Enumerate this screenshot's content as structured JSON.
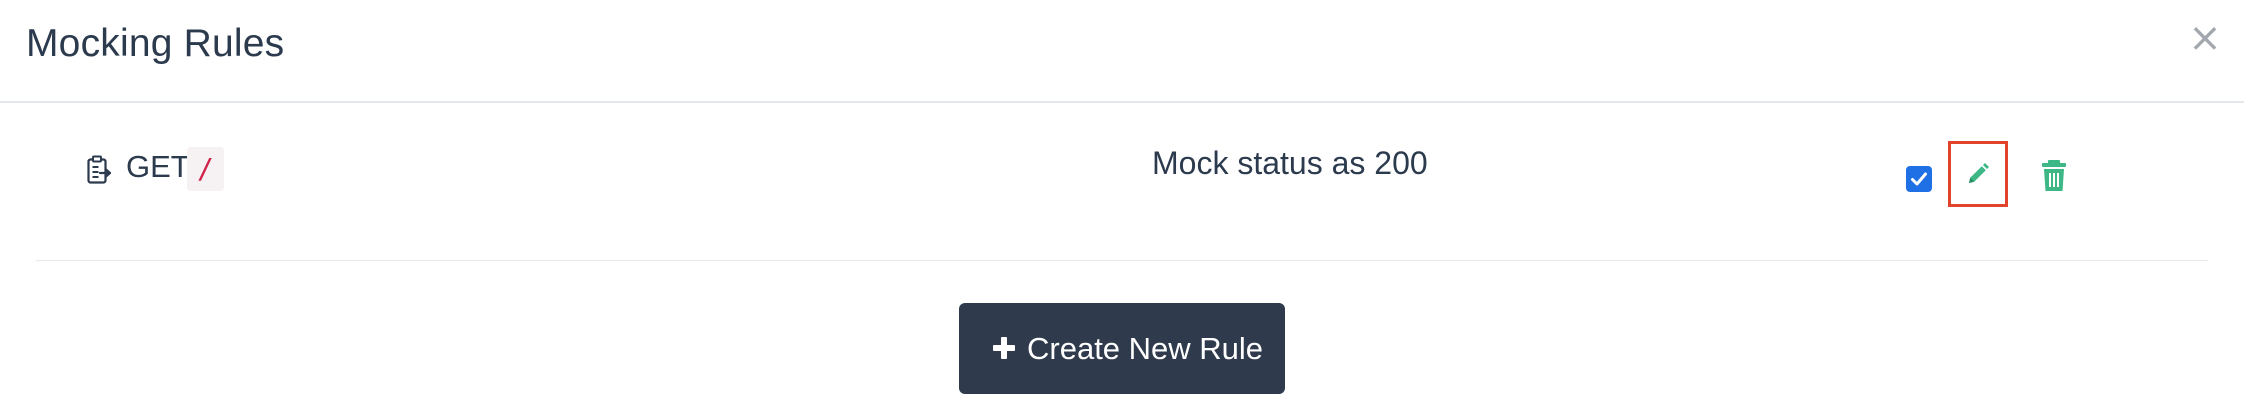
{
  "header": {
    "title": "Mocking Rules",
    "close_label": "×"
  },
  "rules": [
    {
      "icon": "clipboard-icon",
      "method": "GET",
      "path": "/",
      "description": "Mock status as 200",
      "enabled": true
    }
  ],
  "actions": {
    "create_label": "Create New Rule"
  },
  "colors": {
    "text": "#2c3a4e",
    "path_text": "#d0234b",
    "path_bg": "#f6f1f2",
    "checkbox": "#1f6fe5",
    "icon_green": "#3cb785",
    "highlight": "#e2432b",
    "button_bg": "#2f3b4c"
  }
}
